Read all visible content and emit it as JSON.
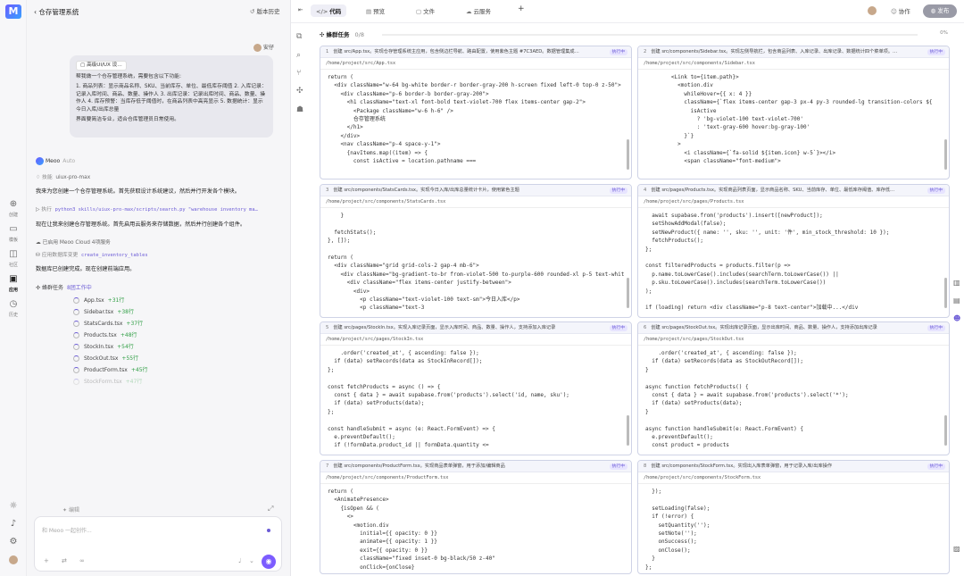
{
  "app": {
    "logo": "M"
  },
  "rail": {
    "items": [
      {
        "label": "创建"
      },
      {
        "label": "模板"
      },
      {
        "label": "社区"
      },
      {
        "label": "应用"
      },
      {
        "label": "历史"
      }
    ]
  },
  "chat": {
    "title": "仓存管理系统",
    "user_name": "安仔",
    "user_message": {
      "attachment": "高级UI/UX 设…",
      "text1": "帮我做一个仓存管理系统，需要包含以下功能:",
      "text2": "1. 商品列表：显示商品名称、SKU、当前库存、单位、最低库存阈值 2. 入库记录：记录入库时间、商品、数量、操作人 3. 出库记录：记录出库时间、商品、数量、操作人 4. 库存预警：当库存低于阈值时，在商品列表中高亮显示 5. 数据统计：显示今日入库/出库总量",
      "text3": "界面要简洁专业，适合仓库管理员日常使用。"
    },
    "agent_name": "Meoo",
    "agent_mode": "Auto",
    "skill": {
      "label": "技能",
      "value": "uiux-pro-max"
    },
    "para1": "我来为您创建一个仓存管理系统。首先获取设计系统建议，然后并行开发各个模块。",
    "exec": {
      "label": "执行",
      "cmd": "python3 skills/uiux-pro-max/scripts/search.py \"warehouse inventory ma…"
    },
    "para2": "现在让我来创建仓存管理系统。首先启用云服务来存储数据，然后并行创建各个组件。",
    "cloud": "已启用 Meoo Cloud  4项服务",
    "db": {
      "label": "应用数据库变更",
      "value": "create_inventory_tables"
    },
    "para3": "数据库已创建完成。现在创建前端应用。",
    "task": {
      "label": "蜂群任务",
      "count": "8团工作中"
    },
    "files": [
      {
        "name": "App.tsx",
        "add": "+31行"
      },
      {
        "name": "Sidebar.tsx",
        "add": "+38行"
      },
      {
        "name": "StatsCards.tsx",
        "add": "+37行"
      },
      {
        "name": "Products.tsx",
        "add": "+48行"
      },
      {
        "name": "StockIn.tsx",
        "add": "+54行"
      },
      {
        "name": "StockOut.tsx",
        "add": "+55行"
      },
      {
        "name": "ProductForm.tsx",
        "add": "+45行"
      },
      {
        "name": "StockForm.tsx",
        "add": "+47行"
      }
    ],
    "edit_label": "编辑",
    "input_placeholder": "和 Meoo 一起创作..."
  },
  "topbar": {
    "history": "版本历史",
    "tab_code": "代码",
    "tab_preview": "预览",
    "tab_files": "文件",
    "tab_cloud": "云服务",
    "add": "+",
    "collab": "协作",
    "publish": "发布"
  },
  "panel": {
    "title": "蜂群任务",
    "count": "0/8",
    "percent": "0%"
  },
  "cards": [
    {
      "no": "1",
      "title": "创建 src/App.tsx。实现仓存管理系统主应用，包含侧边栏导航、路由配置，使用紫色主题 #7C3AED。数据管理集成…",
      "badge": "执行中",
      "path": "/home/project/src/App.tsx",
      "code": "return (\n  <div className=\"w-64 bg-white border-r border-gray-200 h-screen fixed left-0 top-0 z-50\">\n    <div className=\"p-6 border-b border-gray-200\">\n      <h1 className=\"text-xl font-bold text-violet-700 flex items-center gap-2\">\n        <Package className=\"w-6 h-6\" />\n        仓存管理系统\n      </h1>\n    </div>\n    <nav className=\"p-4 space-y-1\">\n      {navItems.map((item) => {\n        const isActive = location.pathname ==="
    },
    {
      "no": "2",
      "title": "创建 src/components/Sidebar.tsx。实现左侧导航栏，包含商品列表、入库记录、出库记录、数据统计四个菜单项。…",
      "badge": "执行中",
      "path": "/home/project/src/components/Sidebar.tsx",
      "code": "        <Link to={item.path}>\n          <motion.div\n            whileHover={{ x: 4 }}\n            className={`flex items-center gap-3 px-4 py-3 rounded-lg transition-colors ${\n              isActive\n                ? 'bg-violet-100 text-violet-700'\n                : 'text-gray-600 hover:bg-gray-100'\n            }`}\n          >\n            <i className={`fa-solid ${item.icon} w-5`}></i>\n            <span className=\"font-medium\">"
    },
    {
      "no": "3",
      "title": "创建 src/components/StatsCards.tsx。实现今日入库/出库总量统计卡片，使用紫色主题",
      "badge": "执行中",
      "path": "/home/project/src/components/StatsCards.tsx",
      "code": "    }\n\n  fetchStats();\n}, []);\n\nreturn (\n  <div className=\"grid grid-cols-2 gap-4 mb-6\">\n    <div className=\"bg-gradient-to-br from-violet-500 to-purple-600 rounded-xl p-5 text-white\n      <div className=\"flex items-center justify-between\">\n        <div>\n          <p className=\"text-violet-100 text-sm\">今日入库</p>\n          <p className=\"text-3"
    },
    {
      "no": "4",
      "title": "创建 src/pages/Products.tsx。实现商品列表页面，显示商品名称、SKU、当前库存、单位、最低库存阈值、库存低…",
      "badge": "执行中",
      "path": "/home/project/src/pages/Products.tsx",
      "code": "  await supabase.from('products').insert([newProduct]);\n  setShowAddModal(false);\n  setNewProduct({ name: '', sku: '', unit: '件', min_stock_threshold: 10 });\n  fetchProducts();\n};\n\nconst filteredProducts = products.filter(p =>\n  p.name.toLowerCase().includes(searchTerm.toLowerCase()) ||\n  p.sku.toLowerCase().includes(searchTerm.toLowerCase())\n);\n\nif (loading) return <div className=\"p-8 text-center\">加载中...</div"
    },
    {
      "no": "5",
      "title": "创建 src/pages/StockIn.tsx。实现入库记录页面，显示入库时间、商品、数量、操作人，支持添加入库记录",
      "badge": "执行中",
      "path": "/home/project/src/pages/StockIn.tsx",
      "code": "    .order('created_at', { ascending: false });\n  if (data) setRecords(data as StockInRecord[]);\n};\n\nconst fetchProducts = async () => {\n  const { data } = await supabase.from('products').select('id, name, sku');\n  if (data) setProducts(data);\n};\n\nconst handleSubmit = async (e: React.FormEvent) => {\n  e.preventDefault();\n  if (!formData.product_id || formData.quantity <="
    },
    {
      "no": "6",
      "title": "创建 src/pages/StockOut.tsx。实现出库记录页面，显示出库时间、商品、数量、操作人，支持添加出库记录",
      "badge": "执行中",
      "path": "/home/project/src/pages/StockOut.tsx",
      "code": "    .order('created_at', { ascending: false });\n  if (data) setRecords(data as StockOutRecord[]);\n}\n\nasync function fetchProducts() {\n  const { data } = await supabase.from('products').select('*');\n  if (data) setProducts(data);\n}\n\nasync function handleSubmit(e: React.FormEvent) {\n  e.preventDefault();\n  const product = products"
    },
    {
      "no": "7",
      "title": "创建 src/components/ProductForm.tsx。实现商品表单弹窗，用于添加/编辑商品",
      "badge": "执行中",
      "path": "/home/project/src/components/ProductForm.tsx",
      "code": "return (\n  <AnimatePresence>\n    {isOpen && (\n      <>\n        <motion.div\n          initial={{ opacity: 0 }}\n          animate={{ opacity: 1 }}\n          exit={{ opacity: 0 }}\n          className=\"fixed inset-0 bg-black/50 z-40\"\n          onClick={onClose}\n        />"
    },
    {
      "no": "8",
      "title": "创建 src/components/StockForm.tsx。实现出入库表单弹窗，用于记录入库/出库操作",
      "badge": "执行中",
      "path": "/home/project/src/components/StockForm.tsx",
      "code": "  });\n\n  setLoading(false);\n  if (!error) {\n    setQuantity('');\n    setNote('');\n    onSuccess();\n    onClose();\n  }\n};\n\nreturn ("
    }
  ]
}
